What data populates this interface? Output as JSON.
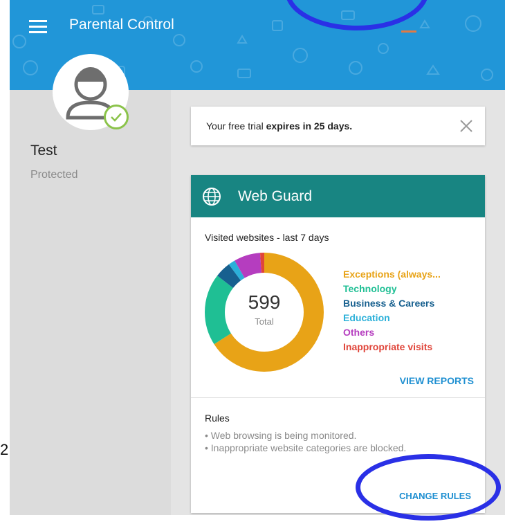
{
  "app_bar": {
    "title": "Parental Control",
    "color": "#2196d8",
    "menu_icon": "hamburger-menu-icon"
  },
  "profile": {
    "name": "Test",
    "status": "Protected",
    "avatar_icon": "user-avatar-icon",
    "badge_icon": "check-circle-icon",
    "badge_color": "#8bc34a"
  },
  "trial": {
    "text_prefix": "Your free trial ",
    "text_bold": "expires in 25 days.",
    "close_icon": "close-icon"
  },
  "web_guard": {
    "title": "Web Guard",
    "header_color": "#188582",
    "icon": "globe-icon",
    "visited_label": "Visited websites - last 7 days",
    "view_reports_label": "VIEW REPORTS",
    "chart_data": {
      "type": "pie",
      "center_value": "599",
      "center_label": "Total",
      "categories": [
        "Exceptions (always...",
        "Technology",
        "Business & Careers",
        "Education",
        "Others",
        "Inappropriate visits"
      ],
      "colors": [
        "#e8a317",
        "#1fbf94",
        "#17608f",
        "#2bb0d9",
        "#b53dbf",
        "#e0453a"
      ],
      "values": [
        395,
        117,
        26,
        11,
        43,
        7
      ]
    }
  },
  "rules": {
    "title": "Rules",
    "items": [
      "• Web browsing is being monitored.",
      "• Inappropriate website categories are blocked."
    ],
    "change_label": "CHANGE RULES"
  },
  "edge_text": "2"
}
